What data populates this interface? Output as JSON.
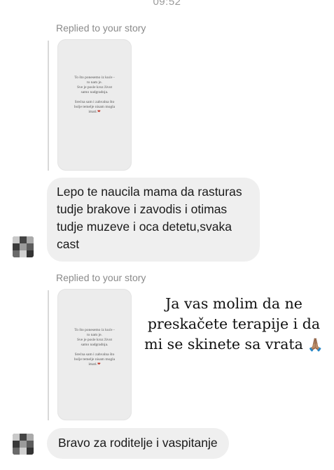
{
  "status_bar": {
    "time": "09:52"
  },
  "messages": [
    {
      "replied_label": "Replied to your story",
      "story_text": "To što ponesemo iz kuće -\nto nam je.\nSve je posle kroz život\nsamo nadgradnja.\n\nSrećna sam i zahvalna što\nbolje temelje nisam mogla\nimati.",
      "story_heart": "❤",
      "text": "Lepo te naucila mama da rasturas tudje brakove i zavodis i otimas tudje muzeve i oca detetu,svaka cast"
    },
    {
      "replied_label": "Replied to your story",
      "story_text": "To što ponesemo iz kuće -\nto nam je.\nSve je posle kroz život\nsamo nadgradnja.\n\nSrećna sam i zahvalna što\nbolje temelje nisam mogla\nimati.",
      "story_heart": "❤",
      "text": "Bravo za roditelje i vaspitanje"
    }
  ],
  "overlay_note": {
    "text": "Ja vas molim da ne\npreskačete terapije i da\nmi se skinete sa vrata",
    "emoji": "🙏🏽"
  }
}
